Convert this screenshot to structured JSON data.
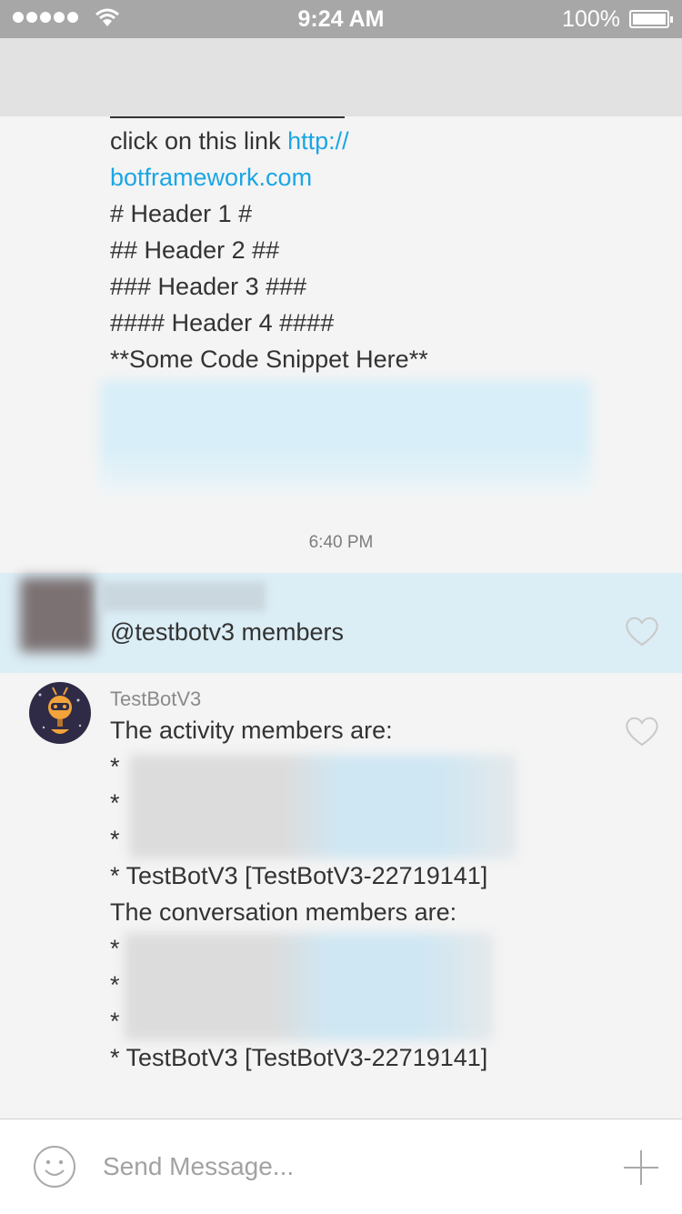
{
  "status_bar": {
    "time": "9:24 AM",
    "battery_percent": "100%"
  },
  "chat": {
    "top_message_lines": [
      "click on this link ",
      "http://",
      "botframework.com",
      "# Header 1 #",
      "## Header 2 ##",
      "### Header 3 ###",
      "#### Header 4 ####",
      "**Some Code Snippet Here**"
    ],
    "timestamp": "6:40 PM",
    "user_message": {
      "text": "@testbotv3 members"
    },
    "bot_message": {
      "sender": "TestBotV3",
      "activity_header": "The activity members are:",
      "activity_bullets": [
        "*",
        "*",
        "*"
      ],
      "activity_bot_line": "* TestBotV3 [TestBotV3-22719141]",
      "conversation_header": "The conversation members are:",
      "conversation_bullets": [
        "*",
        "*",
        "*"
      ],
      "conversation_bot_line": "* TestBotV3 [TestBotV3-22719141]"
    }
  },
  "composer": {
    "placeholder": "Send Message..."
  },
  "colors": {
    "link": "#1ba6e4",
    "highlight": "#dbedf5",
    "status_bar": "#a7a7a7"
  }
}
